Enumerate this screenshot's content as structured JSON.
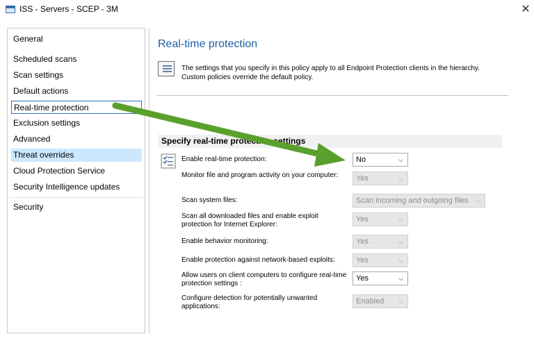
{
  "window": {
    "title": "ISS - Servers - SCEP - 3M",
    "close": "✕"
  },
  "nav": {
    "items": [
      {
        "label": "General"
      },
      {
        "label": "Scheduled scans"
      },
      {
        "label": "Scan settings"
      },
      {
        "label": "Default actions"
      },
      {
        "label": "Real-time protection"
      },
      {
        "label": "Exclusion settings"
      },
      {
        "label": "Advanced"
      },
      {
        "label": "Threat overrides"
      },
      {
        "label": "Cloud Protection Service"
      },
      {
        "label": "Security Intelligence updates"
      },
      {
        "label": "Security"
      }
    ]
  },
  "main": {
    "heading": "Real-time protection",
    "info_line1": "The settings that you specify in this policy apply to all Endpoint Protection clients in the hierarchy.",
    "info_line2": "Custom policies override the default policy.",
    "section_title": "Specify real-time protection settings",
    "rows": [
      {
        "label": "Enable real-time protection:",
        "value": "No",
        "enabled": true
      },
      {
        "label": "Monitor file and program activity on your computer:",
        "value": "Yes",
        "enabled": false
      },
      {
        "label": "Scan system files:",
        "value": "Scan incoming and outgoing files",
        "enabled": false
      },
      {
        "label": "Scan all downloaded files and enable exploit protection for Internet Explorer:",
        "value": "Yes",
        "enabled": false
      },
      {
        "label": "Enable behavior monitoring:",
        "value": "Yes",
        "enabled": false
      },
      {
        "label": "Enable protection against network-based exploits:",
        "value": "Yes",
        "enabled": false
      },
      {
        "label": "Allow users on client computers to configure real-time protection settings :",
        "value": "Yes",
        "enabled": true
      },
      {
        "label": "Configure detection for potentially unwanted applications:",
        "value": "Enabled",
        "enabled": false
      }
    ]
  },
  "colors": {
    "heading": "#1f5fa3",
    "selection": "#cce8ff",
    "arrow": "#5aa02c"
  },
  "icons": {
    "close": "close-icon",
    "chevron": "chevron-down-icon",
    "info": "document-info-icon",
    "settings": "checklist-icon"
  }
}
